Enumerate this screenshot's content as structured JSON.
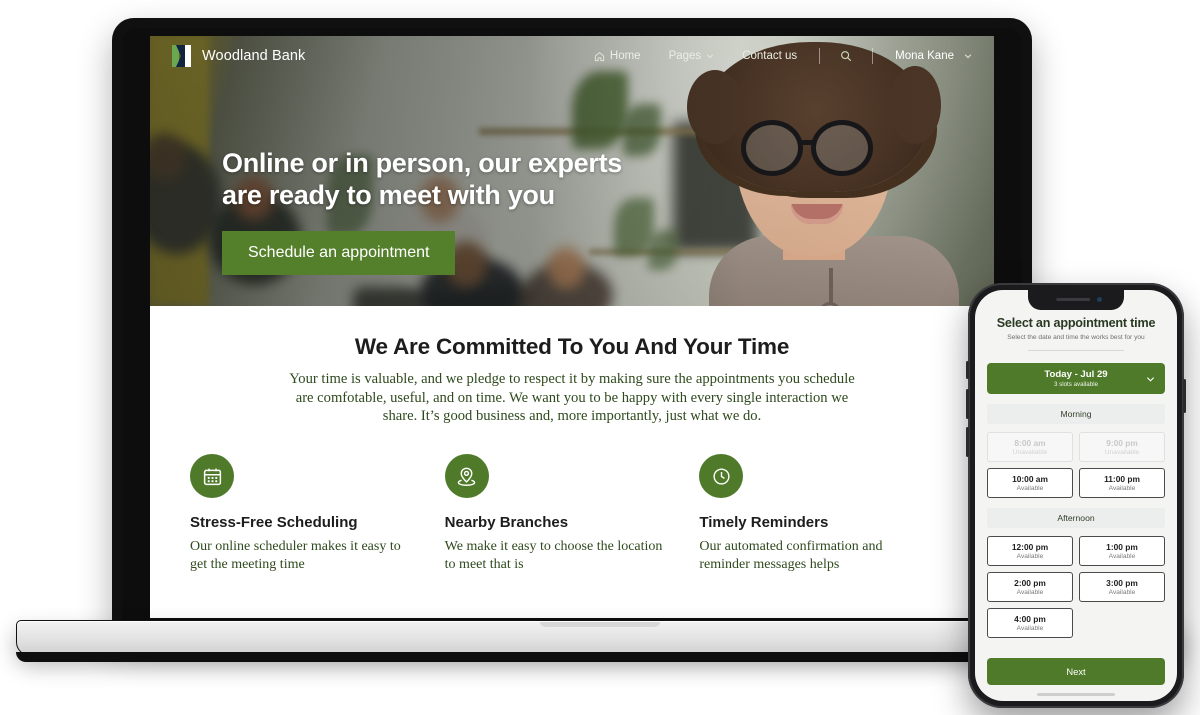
{
  "site": {
    "brand": "Woodland Bank",
    "nav": [
      {
        "label": "Home",
        "icon": "home-icon",
        "caret": false
      },
      {
        "label": "Pages",
        "icon": "",
        "caret": true
      },
      {
        "label": "Contact us",
        "icon": "",
        "caret": false
      }
    ],
    "search_icon": "search-icon",
    "user": "Mona Kane",
    "user_caret": true
  },
  "hero": {
    "title_line1": "Online or in person, our experts",
    "title_line2": "are ready to meet with you",
    "cta": "Schedule an appointment"
  },
  "committed": {
    "title": "We Are Committed To You And Your Time",
    "paragraph": "Your time is valuable, and we pledge to respect it by making sure the appointments you schedule are comfotable, useful, and on time. We want you to be happy with every single interaction we share. It’s good business and, more importantly, just what we do."
  },
  "features": [
    {
      "icon": "calendar-icon",
      "title": "Stress-Free Scheduling",
      "text": "Our online scheduler makes it easy to get the meeting time"
    },
    {
      "icon": "map-pin-icon",
      "title": "Nearby Branches",
      "text": "We make it easy to choose the location to meet that is"
    },
    {
      "icon": "clock-icon",
      "title": "Timely Reminders",
      "text": "Our automated confirmation and reminder messages helps"
    }
  ],
  "phone": {
    "title": "Select an appointment time",
    "subtitle": "Select the date and time the works best for you",
    "date_label": "Today - Jul 29",
    "date_sub": "3 slots available",
    "date_caret": "chevron-down-icon",
    "groups": [
      {
        "label": "Morning",
        "slots": [
          {
            "time": "8:00 am",
            "state": "Unavailable",
            "available": false
          },
          {
            "time": "9:00 pm",
            "state": "Unavailable",
            "available": false
          },
          {
            "time": "10:00 am",
            "state": "Available",
            "available": true
          },
          {
            "time": "11:00 pm",
            "state": "Available",
            "available": true
          }
        ]
      },
      {
        "label": "Afternoon",
        "slots": [
          {
            "time": "12:00 pm",
            "state": "Available",
            "available": true
          },
          {
            "time": "1:00 pm",
            "state": "Available",
            "available": true
          },
          {
            "time": "2:00 pm",
            "state": "Available",
            "available": true
          },
          {
            "time": "3:00 pm",
            "state": "Available",
            "available": true
          },
          {
            "time": "4:00 pm",
            "state": "Available",
            "available": true
          }
        ]
      }
    ],
    "next": "Next"
  },
  "colors": {
    "brand_green": "#4f7a29",
    "cta_green": "#55802b",
    "body_green": "#2f4a1e",
    "logo_navy": "#10243f",
    "logo_green": "#6aa84f",
    "heading_dark": "#1d1d1d"
  }
}
